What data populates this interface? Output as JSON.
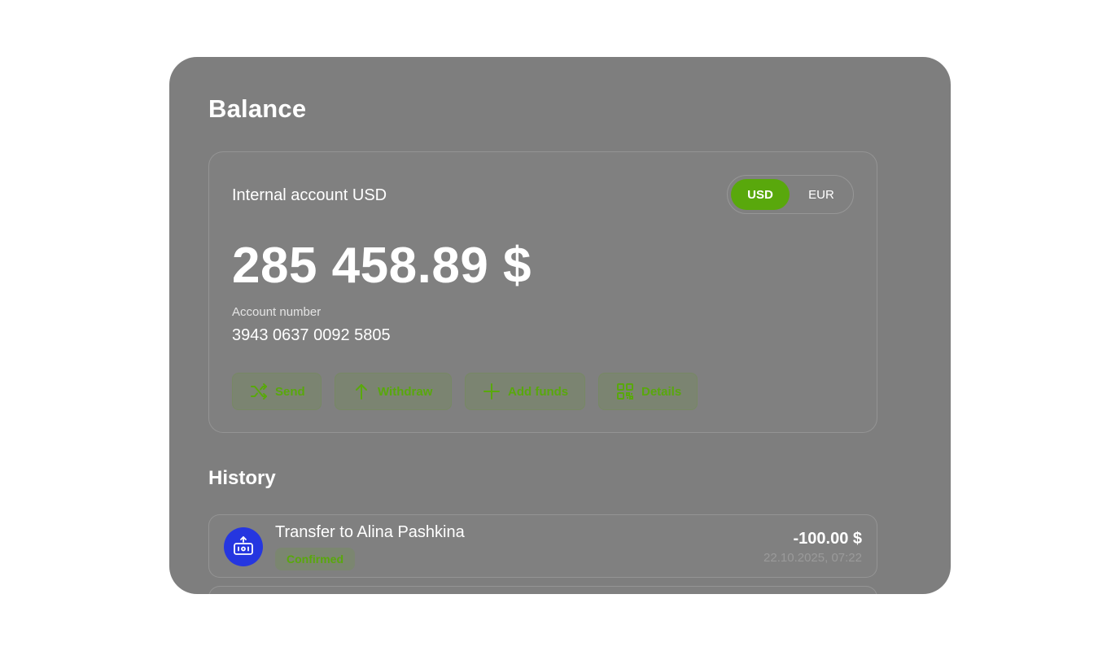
{
  "page": {
    "title": "Balance"
  },
  "account": {
    "title": "Internal account USD",
    "balance": "285 458.89 $",
    "number_label": "Account number",
    "number": "3943 0637 0092 5805"
  },
  "currency_toggle": {
    "options": [
      "USD",
      "EUR"
    ],
    "selected": "USD"
  },
  "actions": {
    "send": "Send",
    "withdraw": "Withdraw",
    "add_funds": "Add funds",
    "details": "Details"
  },
  "history": {
    "title": "History",
    "items": [
      {
        "name": "Transfer to Alina Pashkina",
        "status": "Confirmed",
        "amount": "-100.00 $",
        "date": "22.10.2025, 07:22",
        "icon": "transfer-out-icon"
      }
    ]
  },
  "colors": {
    "accent": "#59a80c",
    "panel": "#7e7e7e",
    "avatar": "#2536e0"
  }
}
